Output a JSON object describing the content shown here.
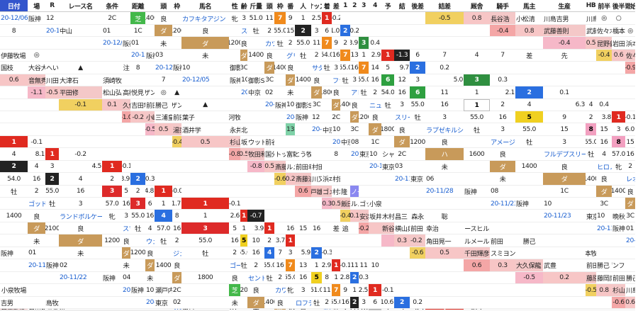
{
  "headers": [
    "日付",
    "場",
    "R",
    "レース名",
    "条件",
    "",
    "距離",
    "",
    "頭",
    "枠",
    "馬名",
    "性",
    "齢",
    "斤量",
    "頭",
    "枠",
    "番",
    "人",
    "オッズ",
    "着",
    "差",
    "1",
    "2",
    "3",
    "4",
    "予",
    "結",
    "後差",
    "詰差",
    "厩舎",
    "騎手",
    "馬主",
    "生産",
    "HB",
    "前半",
    "後半",
    "開始"
  ],
  "rows": [
    [
      "20-12/06",
      "阪神",
      "12",
      "",
      "2C",
      "芝",
      "1400",
      "良",
      "カフキタアジン",
      "牝",
      "3",
      "51.0",
      "11",
      "7",
      "9",
      "1",
      "2.5",
      "1",
      "-0.2",
      "",
      "",
      "",
      "",
      "",
      "",
      "",
      "-0.5",
      "0.8",
      "長谷浩",
      "小松清",
      "川島吉男",
      "川島牧場",
      "◎",
      "○",
      "",
      "8"
    ],
    [
      "20-12/06",
      "中山",
      "01",
      "",
      "1C",
      "ダ",
      "1200",
      "良",
      "スペクタクル",
      "牡",
      "2",
      "55.0",
      "15",
      "2",
      "3",
      "6",
      "11.0",
      "2",
      "0.2",
      "",
      "",
      "",
      "",
      "",
      "",
      "",
      "-0.4",
      "0.8",
      "武藤善則",
      "武藤雅",
      "佐々木雄二",
      "橋本牧場",
      "◎",
      "",
      "",
      ""
    ],
    [
      "20-12/06",
      "阪神",
      "01",
      "",
      "未",
      "ダ",
      "1200",
      "良",
      "カツノサンキュウ",
      "牡",
      "2",
      "55.0",
      "11",
      "7",
      "9",
      "2",
      "3.9",
      "3",
      "0.4",
      "",
      "",
      "",
      "",
      "",
      "",
      "",
      "-0.4",
      "0.5",
      "昆野義",
      "岩田将",
      "浜本兼三",
      "伊藤牧場",
      "◎",
      "",
      "",
      ""
    ],
    [
      "20-12/05",
      "阪神",
      "03",
      "",
      "未",
      "ダ",
      "1400",
      "良",
      "グリューズゴッド",
      "牡",
      "2",
      "54.0",
      "16",
      "7",
      "13",
      "1",
      "2.9",
      "1",
      "-1.3",
      "6",
      "7",
      "4",
      "7",
      "差",
      "先",
      "",
      "-0.4",
      "0.6",
      "佐々木晶",
      "国枝",
      "大谷大",
      "へいほた牧場",
      "▲",
      "",
      "注",
      "8"
    ],
    [
      "20-12/05",
      "阪神",
      "10",
      "御影S",
      "3C",
      "ダ",
      "1400",
      "良",
      "サダムスキャット",
      "牡",
      "3",
      "55.0",
      "16",
      "7",
      "14",
      "5",
      "9.7",
      "2",
      "0.2",
      "",
      "",
      "",
      "",
      "",
      "",
      "",
      "-0.9",
      "0.6",
      "音無秀",
      "川田将",
      "大津石",
      "須崎牧場",
      "",
      "",
      "",
      "7"
    ],
    [
      "20-12/05",
      "阪神",
      "10",
      "御影S",
      "3C",
      "ダ",
      "1400",
      "良",
      "ファシネートゼット",
      "牡",
      "3",
      "55.0",
      "16",
      "6",
      "12",
      "3",
      "5.0",
      "3",
      "0.3",
      "",
      "",
      "",
      "",
      "",
      "",
      "",
      "-1.1",
      "-0.5",
      "平田修",
      "松山弘平",
      "高橋",
      "悦見",
      "ノーザンファ",
      "◎",
      "▲",
      "",
      ""
    ],
    [
      "20-12/05",
      "中京",
      "02",
      "",
      "未",
      "ダ",
      "1800",
      "良",
      "アレナマエストロ",
      "牡",
      "2",
      "54.0",
      "16",
      "6",
      "11",
      "1",
      "2.1",
      "2",
      "0.1",
      "",
      "",
      "",
      "",
      "",
      "",
      "",
      "-0.1",
      "0.1",
      "久保田貴",
      "吉田隼人",
      "前田",
      "勝己",
      "ノーザンファ",
      "▲",
      "",
      "",
      ""
    ],
    [
      "20-12/05",
      "阪神",
      "10",
      "御影S",
      "3C",
      "ダ",
      "1400",
      "良",
      "ニューモニュメント",
      "牡",
      "3",
      "55.0",
      "16",
      "1",
      "2",
      "4",
      "6.3",
      "4",
      "0.4",
      "",
      "",
      "",
      "",
      "",
      "",
      "",
      "-1.0",
      "-0.2",
      "小崎憲",
      "三浦皇成",
      "前田",
      "葉子",
      "浦河牧場",
      "",
      "",
      "",
      ""
    ],
    [
      "20-12/05",
      "阪神",
      "12",
      "",
      "2C",
      "ダ",
      "1200",
      "良",
      "スリーピート",
      "牡",
      "3",
      "55.0",
      "16",
      "5",
      "9",
      "2",
      "3.8",
      "1",
      "-0.1",
      "",
      "",
      "",
      "",
      "",
      "",
      "",
      "-0.5",
      "0.5",
      "湯窪幸雄",
      "酒井学",
      "永井啓事",
      "北星村田牧場",
      "",
      "",
      "",
      "13"
    ],
    [
      "20-12/05",
      "中京",
      "10",
      "",
      "3C",
      "ダ",
      "1800",
      "良",
      "ラプゼキルシュ",
      "牡",
      "3",
      "55.0",
      "15",
      "8",
      "15",
      "3",
      "6.0",
      "1",
      "-0.1",
      "",
      "",
      "",
      "",
      "",
      "",
      "",
      "-0.4",
      "0.5",
      "杉山晴紀",
      "坂井瑠星",
      "ウッドフィールド",
      "前谷武志",
      "",
      "",
      "",
      ""
    ],
    [
      "20-12/05",
      "中京",
      "08",
      "",
      "1C",
      "ダ",
      "1200",
      "良",
      "アメージングラン",
      "牡",
      "3",
      "55.0",
      "16",
      "8",
      "15",
      "4",
      "8.1",
      "1",
      "-0.2",
      "",
      "",
      "",
      "",
      "",
      "",
      "",
      "-0.8",
      "0.5",
      "牧田和弥",
      "国分恭介",
      "トップフェロー",
      "富頼",
      "いとう牧場",
      "",
      "",
      "8"
    ],
    [
      "20-11/29",
      "東京",
      "10",
      "シャングリラ",
      "2C",
      "ハ",
      "1600",
      "良",
      "フルデプスリーダー",
      "牡",
      "4",
      "57.0",
      "16",
      "2",
      "4",
      "3",
      "4.5",
      "1",
      "-0.1",
      "",
      "",
      "",
      "",
      "",
      "",
      "",
      "-0.8",
      "0.5",
      "斎藤誠",
      "ルメール",
      "前田幸治",
      "村田牧場",
      "",
      "",
      "",
      ""
    ],
    [
      "20-11/29",
      "東京",
      "03",
      "",
      "未",
      "ダ",
      "1400",
      "良",
      "ヒロノクイーン",
      "牝",
      "2",
      "54.0",
      "16",
      "2",
      "4",
      "2",
      "3.9",
      "2",
      "0.3",
      "",
      "",
      "",
      "",
      "",
      "",
      "",
      "-0.6",
      "0.2",
      "斎藤清",
      "川又賢治",
      "浜本兼三",
      "村田牧場",
      "",
      "",
      "",
      ""
    ],
    [
      "20-11/28",
      "東京",
      "06",
      "",
      "未",
      "ダ",
      "1400",
      "良",
      "レオンペルガー",
      "牡",
      "2",
      "55.0",
      "16",
      "3",
      "5",
      "2",
      "4.8",
      "1",
      "-0.0",
      "",
      "",
      "",
      "",
      "",
      "",
      "",
      "0.6",
      "鹿戸雄一",
      "ゴメス",
      "村木",
      "隆",
      "ノーザンファ",
      "",
      "",
      "",
      ""
    ],
    [
      "20-11/28",
      "阪神",
      "08",
      "",
      "1C",
      "ダ",
      "1400",
      "良",
      "ゴッドバンブルビー",
      "牡",
      "3",
      "57.0",
      "16",
      "3",
      "6",
      "1",
      "1.7",
      "1",
      "-0.1",
      "",
      "",
      "",
      "",
      "",
      "",
      "",
      "0.3",
      "0.5",
      "飯田祐史",
      "ルメール",
      "ゴッドアステリズム",
      "小泉",
      "",
      "",
      "",
      ""
    ],
    [
      "20-11/23",
      "阪神",
      "10",
      "",
      "3C",
      "ダ",
      "1400",
      "良",
      "ランドボルケーノ",
      "牝",
      "3",
      "55.0",
      "16",
      "4",
      "8",
      "1",
      "2.6",
      "1",
      "-0.7",
      "",
      "",
      "",
      "",
      "",
      "",
      "",
      "-0.4",
      "0.1",
      "安達昭夫",
      "坂井瑠星",
      "木村",
      "昌三",
      "森永",
      "聡",
      "",
      "",
      ""
    ],
    [
      "20-11/23",
      "東京",
      "10",
      "晩秋S",
      "3C",
      "ダ",
      "2100",
      "良",
      "スマッシングハーツ",
      "牡",
      "4",
      "57.0",
      "16",
      "3",
      "5",
      "1",
      "3.9",
      "1",
      "",
      "16",
      "15",
      "16",
      "",
      "差",
      "追",
      "",
      "-0.2",
      "",
      "新谷功一",
      "横山典弘",
      "前田",
      "幸治",
      "ノースヒルズ",
      "",
      "",
      "",
      ""
    ],
    [
      "20-11/22",
      "阪神",
      "01",
      "",
      "未",
      "ダ",
      "1200",
      "良",
      "ウェルドーン",
      "牡",
      "2",
      "55.0",
      "16",
      "5",
      "10",
      "2",
      "3.7",
      "1",
      "",
      "",
      "",
      "",
      "",
      "",
      "",
      "",
      "",
      "0.3",
      "-0.2",
      "角田晃一",
      "ルメール",
      "前田",
      "勝己",
      "",
      "",
      "",
      ""
    ],
    [
      "20-11/22",
      "阪神",
      "01",
      "",
      "未",
      "ダ",
      "1200",
      "良",
      "ジェットエンブレム",
      "牡",
      "2",
      "55.0",
      "16",
      "4",
      "7",
      "3",
      "5.9",
      "2",
      "-0.3",
      "",
      "",
      "",
      "",
      "",
      "",
      "",
      "-0.6",
      "0.5",
      "千田輝彦",
      "スミヨン",
      "",
      "",
      "浜本牧場",
      "",
      "",
      "",
      ""
    ],
    [
      "20-11/22",
      "阪神",
      "02",
      "",
      "未",
      "ダ",
      "1400",
      "良",
      "ゴールドハイアー",
      "牡",
      "2",
      "55.0",
      "16",
      "7",
      "13",
      "1",
      "2.9",
      "1",
      "-0.1",
      "11",
      "11",
      "10",
      "",
      "",
      "",
      "",
      "0.6",
      "0.3",
      "大久保龍",
      "武豊",
      "前田",
      "勝己",
      "ノーザンファーム",
      "",
      "",
      "",
      ""
    ],
    [
      "20-11/22",
      "阪神",
      "04",
      "",
      "未",
      "ダ",
      "1800",
      "良",
      "セントセントラル",
      "牡",
      "2",
      "55.0",
      "16",
      "5",
      "8",
      "1",
      "2.8",
      "2",
      "0.3",
      "",
      "",
      "",
      "",
      "",
      "",
      "",
      "-0.5",
      "0.2",
      "藤原英昭",
      "藤岡康太",
      "前田",
      "勝己",
      "小泉牧場",
      "",
      "",
      "",
      ""
    ],
    [
      "20-11/21",
      "阪神",
      "10",
      "瀬戸内海特別",
      "2C",
      "芝",
      "1200",
      "良",
      "カワキタアジン",
      "牝",
      "3",
      "51.0",
      "11",
      "7",
      "9",
      "1",
      "2.5",
      "1",
      "-0.1",
      "",
      "",
      "",
      "",
      "",
      "",
      "",
      "-0.5",
      "0.8",
      "杉山晴紀",
      "川島",
      "吉男",
      "",
      "川島牧場",
      "",
      "",
      "",
      ""
    ],
    [
      "20-11/21",
      "東京",
      "02",
      "",
      "未",
      "ダ",
      "1400",
      "良",
      "ロフティフェルト",
      "牡",
      "2",
      "55.0",
      "16",
      "2",
      "3",
      "6",
      "10.6",
      "2",
      "0.2",
      "",
      "",
      "",
      "",
      "",
      "",
      "",
      "-0.6",
      "0.6",
      "石栗龍彦",
      "石川裕紀",
      "浜本",
      "健",
      "",
      "",
      "",
      ""
    ],
    [
      "20-11/21",
      "東京",
      "01",
      "",
      "未",
      "ダ",
      "1300",
      "良",
      "ホワイトクラウ",
      "牡",
      "2",
      "55.0",
      "16",
      "1",
      "1",
      "3",
      "4.7",
      "1",
      "-0.1",
      "",
      "",
      "",
      "",
      "",
      "",
      "",
      "-0.6",
      "0.6",
      "矢野英一",
      "横山武史",
      "キャロットF",
      "社台コーポ",
      "",
      "",
      "",
      ""
    ]
  ]
}
